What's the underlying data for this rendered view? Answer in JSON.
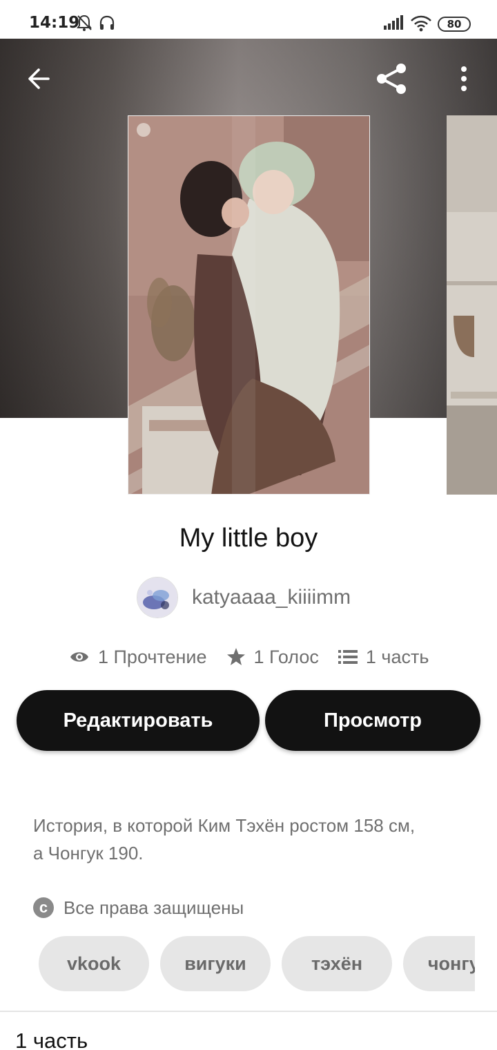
{
  "status_bar": {
    "time": "14:19",
    "battery": "80",
    "icons": [
      "bell-off-icon",
      "headset-icon",
      "signal-icon",
      "wifi-icon"
    ]
  },
  "header": {
    "back_icon": "arrow-left-icon",
    "share_icon": "share-icon",
    "menu_icon": "more-vertical-icon"
  },
  "story": {
    "title": "My little boy",
    "author": "katyaaaa_kiiiimm",
    "stats": {
      "reads": "1 Прочтение",
      "votes": "1 Голос",
      "parts": "1 часть"
    },
    "description_line1": "История, в которой Ким Тэхён ростом 158 см,",
    "description_line2": "а Чонгук 190.",
    "copyright": "Все права защищены",
    "tags": [
      "vkook",
      "вигуки",
      "тэхён",
      "чонгук"
    ]
  },
  "actions": {
    "edit_label": "Редактировать",
    "view_label": "Просмотр"
  },
  "parts_section": {
    "heading": "1 часть"
  },
  "colors": {
    "button_bg": "#121212",
    "tag_bg": "#e6e6e6",
    "muted_text": "#6f6f6f"
  }
}
